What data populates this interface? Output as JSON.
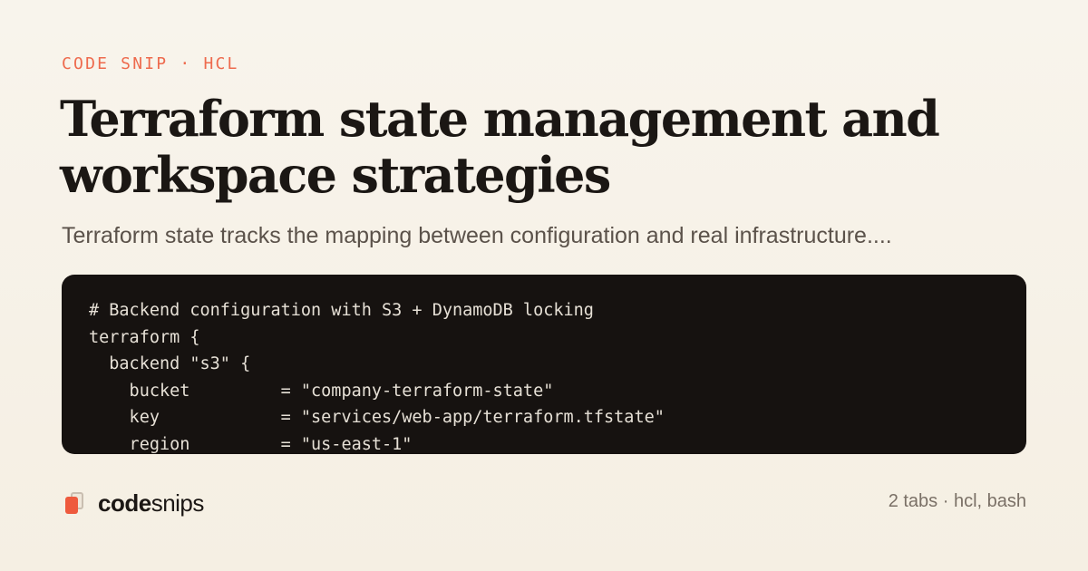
{
  "eyebrow": "CODE SNIP · HCL",
  "title": "Terraform state management and workspace strategies",
  "subtitle": "Terraform state tracks the mapping between configuration and real infrastructure....",
  "code": {
    "language": "hcl",
    "lines": [
      "# Backend configuration with S3 + DynamoDB locking",
      "terraform {",
      "  backend \"s3\" {",
      "    bucket         = \"company-terraform-state\"",
      "    key            = \"services/web-app/terraform.tfstate\"",
      "    region         = \"us-east-1\""
    ]
  },
  "brand": {
    "name_bold": "code",
    "name_light": "snips",
    "icon": "stacked-pages-icon"
  },
  "meta": "2 tabs · hcl, bash",
  "colors": {
    "accent": "#ee6a4d",
    "background": "#f6f1e7",
    "code_background": "#161210",
    "title": "#1b1714"
  }
}
